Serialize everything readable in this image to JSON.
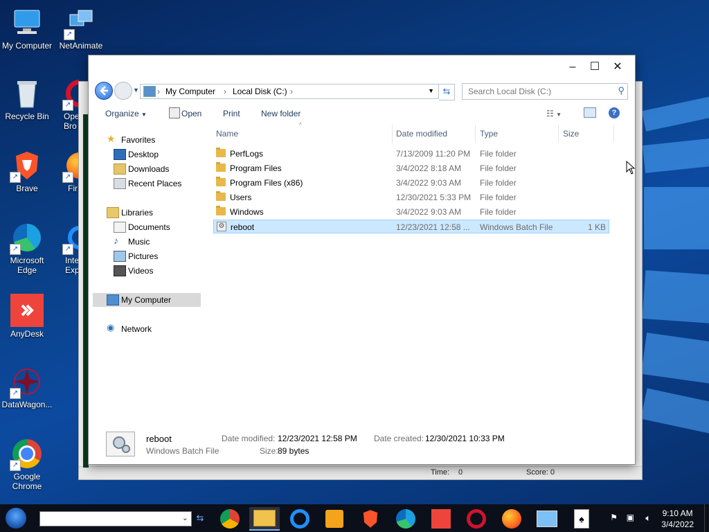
{
  "desktop": {
    "icons": [
      {
        "label": "My Computer"
      },
      {
        "label": "NetAnimate"
      },
      {
        "label": "Recycle Bin"
      },
      {
        "label": "Ope\nBro"
      },
      {
        "label": "Brave"
      },
      {
        "label": "Fir"
      },
      {
        "label": "Microsoft\nEdge"
      },
      {
        "label": "Inte\nExp"
      },
      {
        "label": "AnyDesk"
      },
      {
        "label": "DataWagon..."
      },
      {
        "label": "Google\nChrome"
      }
    ]
  },
  "background_window": {
    "status_time": "Time:",
    "status_time_value": "0",
    "status_score": "Score: 0"
  },
  "explorer": {
    "address": {
      "crumbs": [
        "My Computer",
        "Local Disk (C:)"
      ]
    },
    "search": {
      "placeholder": "Search Local Disk (C:)"
    },
    "toolbar": {
      "organize": "Organize",
      "open": "Open",
      "print": "Print",
      "new_folder": "New folder"
    },
    "nav": {
      "favorites": "Favorites",
      "desktop": "Desktop",
      "downloads": "Downloads",
      "recent_places": "Recent Places",
      "libraries": "Libraries",
      "documents": "Documents",
      "music": "Music",
      "pictures": "Pictures",
      "videos": "Videos",
      "my_computer": "My Computer",
      "network": "Network"
    },
    "columns": {
      "name": "Name",
      "date_modified": "Date modified",
      "type": "Type",
      "size": "Size"
    },
    "files": [
      {
        "name": "PerfLogs",
        "date": "7/13/2009 11:20 PM",
        "type": "File folder",
        "size": "",
        "kind": "folder"
      },
      {
        "name": "Program Files",
        "date": "3/4/2022 8:18 AM",
        "type": "File folder",
        "size": "",
        "kind": "folder"
      },
      {
        "name": "Program Files (x86)",
        "date": "3/4/2022 9:03 AM",
        "type": "File folder",
        "size": "",
        "kind": "folder"
      },
      {
        "name": "Users",
        "date": "12/30/2021 5:33 PM",
        "type": "File folder",
        "size": "",
        "kind": "folder"
      },
      {
        "name": "Windows",
        "date": "3/4/2022 9:03 AM",
        "type": "File folder",
        "size": "",
        "kind": "folder"
      },
      {
        "name": "reboot",
        "date": "12/23/2021 12:58 ...",
        "type": "Windows Batch File",
        "size": "1 KB",
        "kind": "batch"
      }
    ],
    "details": {
      "name": "reboot",
      "type": "Windows Batch File",
      "date_modified_label": "Date modified:",
      "date_modified": "12/23/2021 12:58 PM",
      "date_created_label": "Date created:",
      "date_created": "12/30/2021 10:33 PM",
      "size_label": "Size:",
      "size": "89 bytes"
    }
  },
  "taskbar": {
    "time": "9:10 AM",
    "date": "3/4/2022",
    "apps": [
      "chrome-icon",
      "file-explorer-icon",
      "internet-explorer-icon",
      "media-player-icon",
      "brave-icon",
      "edge-icon",
      "anydesk-icon",
      "opera-icon",
      "firefox-icon",
      "netanimate-icon",
      "solitaire-icon"
    ]
  },
  "colors": {
    "selection_bg": "#cce8ff",
    "selection_border": "#99d1ff",
    "taskbar_bg": "#0b0f1a",
    "desktop_bg": "#0a3f86"
  }
}
